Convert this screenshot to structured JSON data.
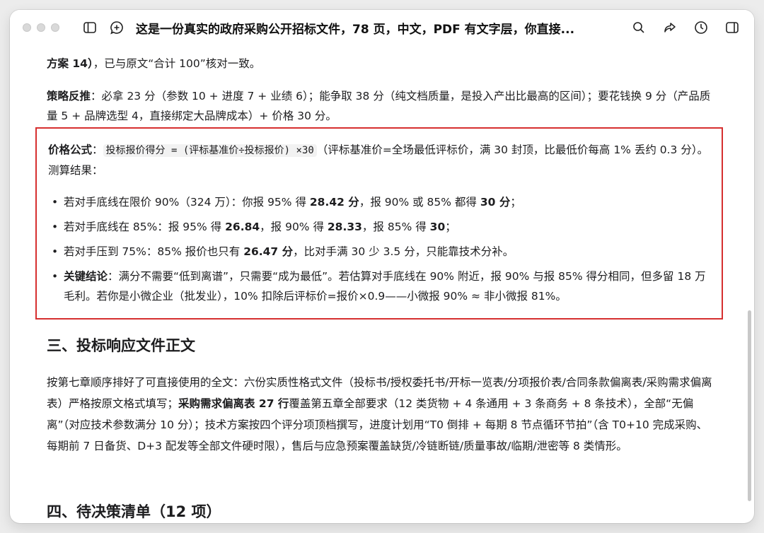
{
  "window": {
    "title": "这是一份真实的政府采购公开招标文件，78 页，中文，PDF 有文字层，你直接..."
  },
  "icons": {
    "sidebar": "sidebar-toggle-icon",
    "new_chat": "chat-plus-icon",
    "search": "search-icon",
    "share": "share-icon",
    "history": "clock-icon",
    "panel": "right-panel-icon"
  },
  "content": {
    "p1": {
      "bold": "方案 14）",
      "rest": "，已与原文“合计 100”核对一致。"
    },
    "p2": {
      "bold": "策略反推",
      "rest": "：必拿 23 分（参数 10 + 进度 7 + 业绩 6）；能争取 38 分（纯文档质量，是投入产出比最高的区间）；要花钱换 9 分（产品质量 5 + 品牌选型 4，直接绑定大品牌成本）+ 价格 30 分。"
    },
    "price": {
      "label": "价格公式",
      "colon": "：",
      "formula": "投标报价得分 = (评标基准价÷投标报价) ×30",
      "rest": "（评标基准价=全场最低评标价，满 30 封顶，比最低价每高 1% 丢约 0.3 分）。测算结果："
    },
    "bullets": [
      {
        "t1": "若对手底线在限价 90%（324 万）：你报 95% 得 ",
        "b1": "28.42 分",
        "t2": "，报 90% 或 85% 都得 ",
        "b2": "30 分",
        "t3": "；"
      },
      {
        "t1": "若对手底线在 85%：报 95% 得 ",
        "b1": "26.84",
        "t2": "，报 90% 得 ",
        "b2": "28.33",
        "t3": "，报 85% 得 ",
        "b3": "30",
        "t4": "；"
      },
      {
        "t1": "若对手压到 75%：85% 报价也只有 ",
        "b1": "26.47 分",
        "t2": "，比对手满 30 少 3.5 分，只能靠技术分补。"
      },
      {
        "b0": "关键结论",
        "t1": "：满分不需要“低到离谱”，只需要“成为最低”。若估算对手底线在 90% 附近，报 90% 与报 85% 得分相同，但多留 18 万毛利。若你是小微企业（批发业），10% 扣除后评标价=报价×0.9——小微报 90% ≈ 非小微报 81%。"
      }
    ],
    "h3": "三、投标响应文件正文",
    "p4": {
      "t1": "按第七章顺序排好了可直接使用的全文：六份实质性格式文件（投标书/授权委托书/开标一览表/分项报价表/合同条款偏离表/采购需求偏离表）严格按原文格式填写；",
      "b1": "采购需求偏离表 27 行",
      "t2": "覆盖第五章全部要求（12 类货物 + 4 条通用 + 3 条商务 + 8 条技术），全部“无偏离”（对应技术参数满分 10 分）；技术方案按四个评分项顶档撰写，进度计划用“T0 倒排 + 每期 8 节点循环节拍”（含 T0+10 完成采购、每期前 7 日备货、D+3 配发等全部文件硬时限），售后与应急预案覆盖缺货/冷链断链/质量事故/临期/泄密等 8 类情形。"
    },
    "h4": "四、待决策清单（12 项）"
  }
}
